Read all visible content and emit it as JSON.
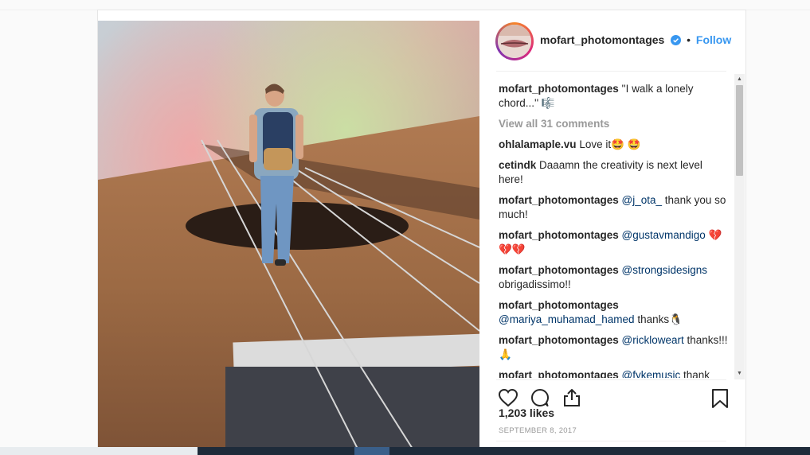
{
  "post": {
    "username": "mofart_photomontages",
    "follow_label": "Follow",
    "dot": "•",
    "caption": "''I walk a lonely chord...'' 🎼",
    "view_all": "View all 31 comments",
    "comments": [
      {
        "user": "ohlalamaple.vu",
        "text": "Love it🤩 🤩"
      },
      {
        "user": "cetindk",
        "text": "Daaamn the creativity is next level here!"
      },
      {
        "user": "mofart_photomontages",
        "mention": "@j_ota_",
        "text": "thank you so much!"
      },
      {
        "user": "mofart_photomontages",
        "mention": "@gustavmandigo",
        "text": "💔💔💔"
      },
      {
        "user": "mofart_photomontages",
        "mention": "@strongsidesigns",
        "text": "obrigadissimo!!"
      },
      {
        "user": "mofart_photomontages",
        "mention": "@mariya_muhamad_hamed",
        "text": "thanks🐧"
      },
      {
        "user": "mofart_photomontages",
        "mention": "@rickloweart",
        "text": "thanks!!!🙏"
      },
      {
        "user": "mofart_photomontages",
        "mention": "@fykemusic",
        "text": "thank"
      }
    ],
    "likes": "1,203 likes",
    "date": "SEPTEMBER 8, 2017"
  },
  "icons": {
    "avatar": "avatar-lips-icon",
    "verified": "verified-badge-icon",
    "like": "heart-icon",
    "comment": "comment-bubble-icon",
    "share": "share-icon",
    "save": "bookmark-icon"
  },
  "colors": {
    "accent": "#3897f0",
    "text": "#262626",
    "muted": "#999999",
    "border": "#efefef"
  }
}
